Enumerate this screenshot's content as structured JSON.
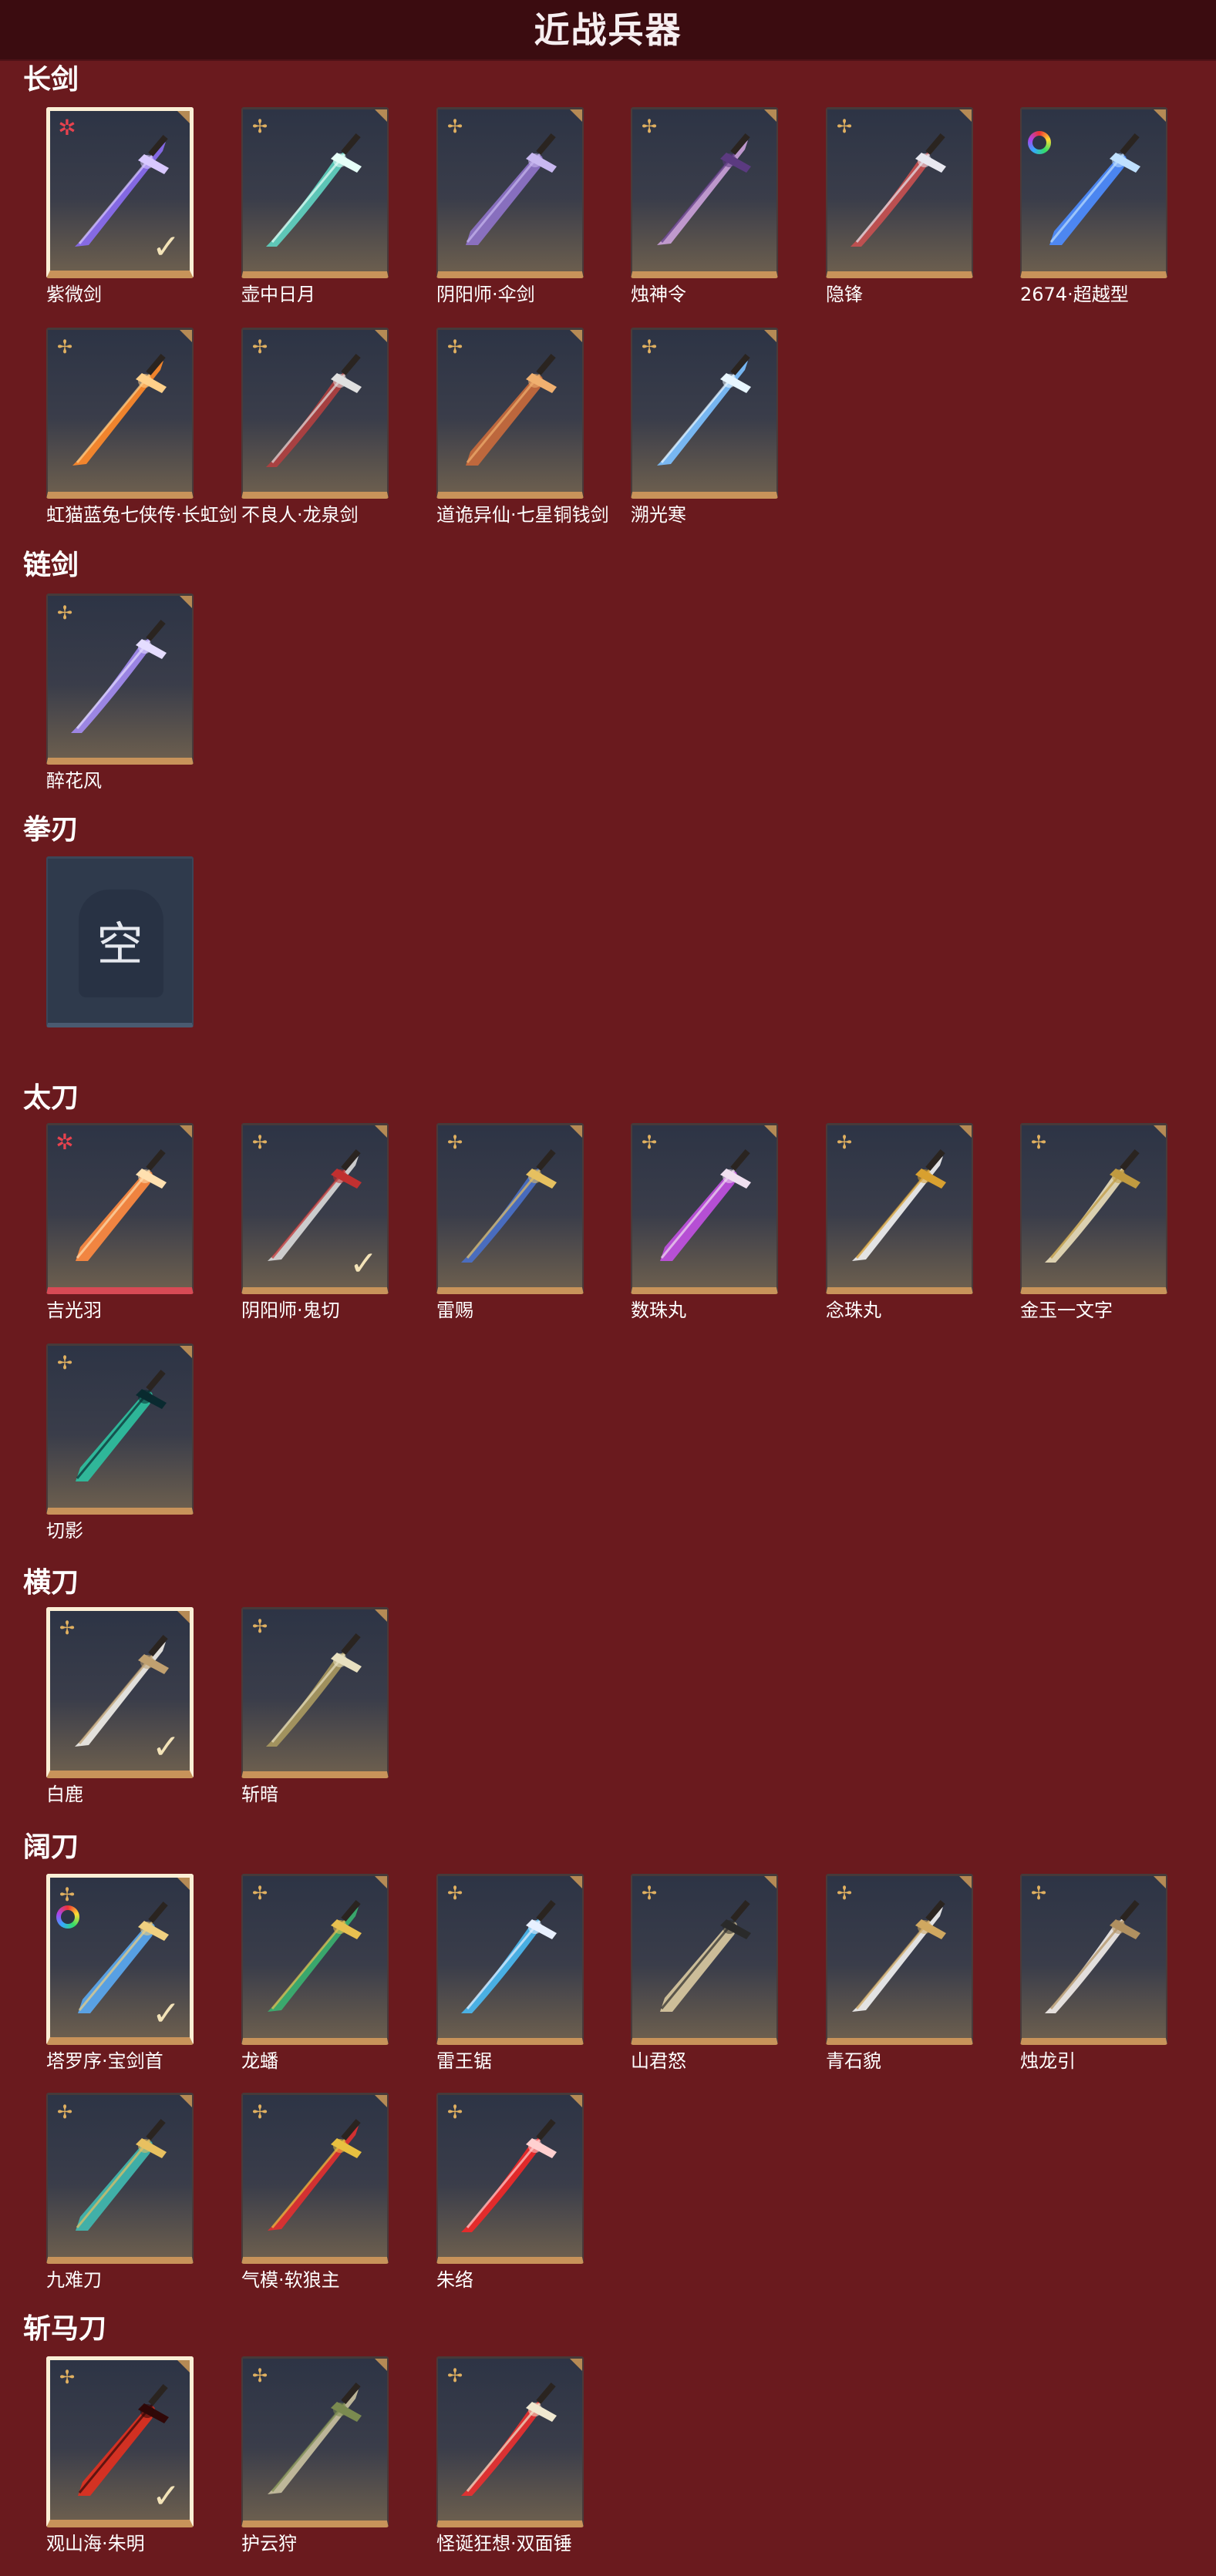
{
  "header": {
    "title": "近战兵器"
  },
  "categories": [
    {
      "name": "长剑",
      "items": [
        {
          "name": "紫微剑",
          "badge": "star",
          "selected": true,
          "color": "#8a6cf0",
          "accent": "#d8c8ff"
        },
        {
          "name": "壶中日月",
          "badge": "flower",
          "color": "#5fd1c0",
          "accent": "#e6fff8"
        },
        {
          "name": "阴阳师·伞剑",
          "badge": "flower",
          "color": "#8e73c8",
          "accent": "#c8b8f0"
        },
        {
          "name": "烛神令",
          "badge": "flower",
          "color": "#c9a0d8",
          "accent": "#5b3a80"
        },
        {
          "name": "隐锋",
          "badge": "flower",
          "color": "#c55050",
          "accent": "#e8e8f0"
        },
        {
          "name": "2674·超越型",
          "badge": "ring",
          "color": "#4d8cff",
          "accent": "#bfe0ff"
        },
        {
          "name": "虹猫蓝兔七侠传·长虹剑",
          "badge": "flower",
          "color": "#ff8a2a",
          "accent": "#ffd08a"
        },
        {
          "name": "不良人·龙泉剑",
          "badge": "flower",
          "color": "#b04040",
          "accent": "#e0e0e0"
        },
        {
          "name": "道诡异仙·七星铜钱剑",
          "badge": "flower",
          "color": "#c86a3c",
          "accent": "#f0b070"
        },
        {
          "name": "溯光寒",
          "badge": "flower",
          "color": "#7cc0ff",
          "accent": "#e8f6ff"
        }
      ]
    },
    {
      "name": "链剑",
      "items": [
        {
          "name": "醉花风",
          "badge": "flower",
          "color": "#a38bf0",
          "accent": "#e5ddff"
        }
      ]
    },
    {
      "name": "拳刃",
      "items": [
        {
          "name": "",
          "empty": true,
          "glyph": "空"
        }
      ]
    },
    {
      "name": "太刀",
      "items": [
        {
          "name": "吉光羽",
          "badge": "star",
          "color": "#ff8a40",
          "accent": "#ffe0b0",
          "red": true
        },
        {
          "name": "阴阳师·鬼切",
          "badge": "flower",
          "selected_check": true,
          "color": "#d8d8d8",
          "accent": "#c03030"
        },
        {
          "name": "雷赐",
          "badge": "flower",
          "color": "#4a70c8",
          "accent": "#e6c060"
        },
        {
          "name": "数珠丸",
          "badge": "flower",
          "color": "#c050e0",
          "accent": "#f0e0f0"
        },
        {
          "name": "念珠丸",
          "badge": "flower",
          "color": "#f0f0f0",
          "accent": "#d8a030"
        },
        {
          "name": "金玉一文字",
          "badge": "flower",
          "color": "#e8dcb8",
          "accent": "#c09a40"
        },
        {
          "name": "切影",
          "badge": "flower",
          "color": "#2ec0a0",
          "accent": "#0a2a30"
        }
      ]
    },
    {
      "name": "横刀",
      "items": [
        {
          "name": "白鹿",
          "badge": "flower",
          "selected": true,
          "color": "#f0eee8",
          "accent": "#c0a070"
        },
        {
          "name": "斩暗",
          "badge": "flower",
          "color": "#a89860",
          "accent": "#e8e0c0"
        }
      ]
    },
    {
      "name": "阔刀",
      "items": [
        {
          "name": "塔罗序·宝剑首",
          "badge": "flower",
          "badge2": "ring",
          "selected": true,
          "color": "#5aa8f0",
          "accent": "#f0d080"
        },
        {
          "name": "龙蟠",
          "badge": "flower",
          "color": "#3ab070",
          "accent": "#e8c050"
        },
        {
          "name": "雷王锯",
          "badge": "flower",
          "color": "#4ab8f0",
          "accent": "#e8f0ff"
        },
        {
          "name": "山君怒",
          "badge": "flower",
          "color": "#d8c8a0",
          "accent": "#2a2a2a"
        },
        {
          "name": "青石貌",
          "badge": "flower",
          "color": "#f0f0f0",
          "accent": "#d0a860"
        },
        {
          "name": "烛龙引",
          "badge": "flower",
          "color": "#f0ece8",
          "accent": "#b09060"
        },
        {
          "name": "九难刀",
          "badge": "flower",
          "color": "#40b8b0",
          "accent": "#e8c060"
        },
        {
          "name": "气模·软狼主",
          "badge": "flower",
          "color": "#e03030",
          "accent": "#e8c040"
        },
        {
          "name": "朱络",
          "badge": "flower",
          "color": "#f02828",
          "accent": "#ffd0d0"
        }
      ]
    },
    {
      "name": "斩马刀",
      "items": [
        {
          "name": "观山海·朱明",
          "badge": "flower",
          "selected": true,
          "color": "#e03020",
          "accent": "#300808"
        },
        {
          "name": "护云狩",
          "badge": "flower",
          "color": "#c8c0a0",
          "accent": "#7a8a50"
        },
        {
          "name": "怪诞狂想·双面锤",
          "badge": "flower",
          "color": "#e83030",
          "accent": "#f0e8d0"
        }
      ]
    }
  ],
  "icons": {
    "badge_flower": "✢",
    "badge_star": "✲",
    "check": "✓"
  },
  "colors": {
    "background": "#6a1a1e",
    "header": "#3b0c10",
    "card_base": "#c8935a",
    "selected_border": "#fbefd6"
  }
}
